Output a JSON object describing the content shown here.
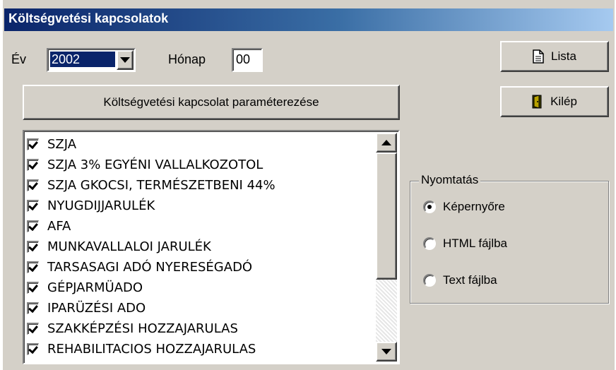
{
  "window": {
    "title": "Költségvetési kapcsolatok"
  },
  "filters": {
    "year_label": "Év",
    "year_value": "2002",
    "month_label": "Hónap",
    "month_value": "00"
  },
  "buttons": {
    "params_label": "Költségvetési kapcsolat paraméterezése",
    "lista_label": "Lista",
    "kilep_label": "Kilép"
  },
  "list": {
    "items": [
      {
        "label": "SZJA",
        "checked": true
      },
      {
        "label": "SZJA 3% EGYÉNI VALLALKOZOTOL",
        "checked": true
      },
      {
        "label": "SZJA GKOCSI, TERMÉSZETBENI 44%",
        "checked": true
      },
      {
        "label": "NYUGDIJJARULÉK",
        "checked": true
      },
      {
        "label": "AFA",
        "checked": true
      },
      {
        "label": "MUNKAVALLALOI JARULÉK",
        "checked": true
      },
      {
        "label": "TARSASAGI ADÓ NYERESÉGADÓ",
        "checked": true
      },
      {
        "label": "GÉPJARMÜADO",
        "checked": true
      },
      {
        "label": "IPARÜZÉSI ADO",
        "checked": true
      },
      {
        "label": "SZAKKÉPZÉSI HOZZAJARULAS",
        "checked": true
      },
      {
        "label": "REHABILITACIOS HOZZAJARULAS",
        "checked": true
      }
    ]
  },
  "print": {
    "group_title": "Nyomtatás",
    "options": [
      {
        "label": "Képernyőre",
        "selected": true
      },
      {
        "label": "HTML fájlba",
        "selected": false
      },
      {
        "label": "Text fájlba",
        "selected": false
      }
    ]
  }
}
